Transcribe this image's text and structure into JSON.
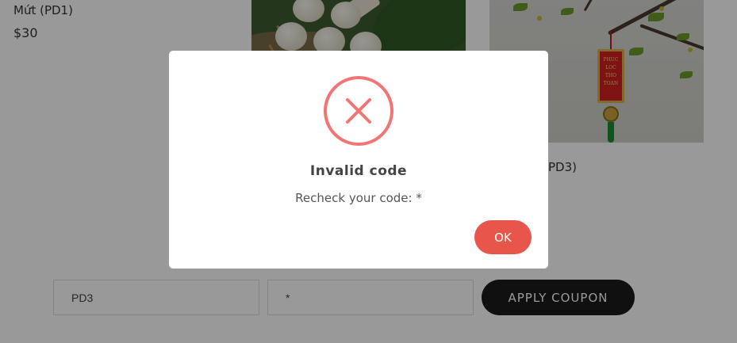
{
  "products": [
    {
      "name": "Mứt (PD1)",
      "price": "$30"
    },
    {
      "image": "banh-tet-buns-photo"
    },
    {
      "name_tail": "PD3)",
      "image": "apricot-blossom-ornament-photo",
      "ornament_text": "PHUC LOC THO TOAN"
    }
  ],
  "coupon": {
    "product_value": "PD3",
    "code_value": "*",
    "apply_label": "APPLY COUPON"
  },
  "modal": {
    "icon": "error-x-icon",
    "title": "Invalid code",
    "message": "Recheck your code: *",
    "ok_label": "OK",
    "accent_color": "#f27474",
    "button_color": "#e8554a"
  }
}
